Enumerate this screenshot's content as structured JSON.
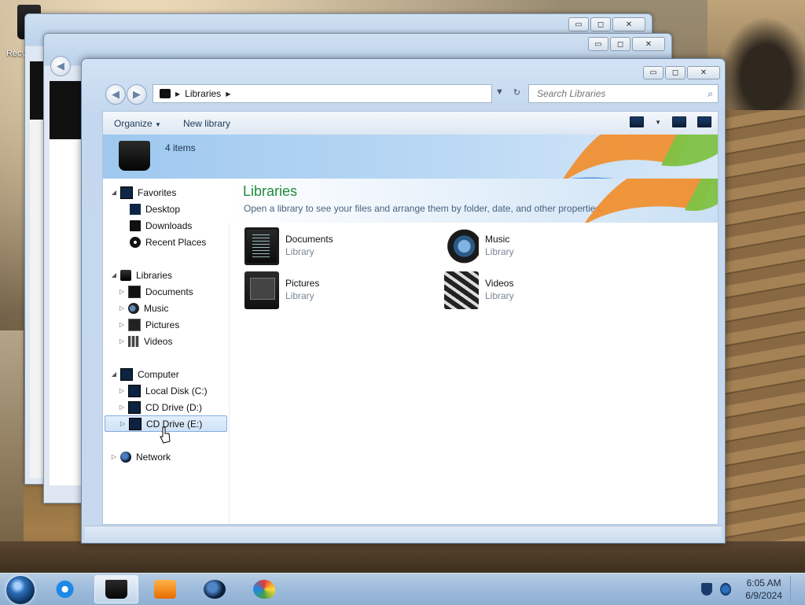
{
  "desktop": {
    "recycle_label": "Recycle Bin"
  },
  "window": {
    "buttons": {
      "minimize": "▭",
      "maximize": "◻",
      "close": "✕"
    },
    "address": {
      "crumbs": [
        "Libraries"
      ],
      "search_placeholder": "Search Libraries"
    },
    "toolbar": {
      "organize": "Organize",
      "new_library": "New library"
    },
    "header": {
      "item_count": "4 items"
    },
    "nav": {
      "favorites": {
        "label": "Favorites",
        "items": [
          "Desktop",
          "Downloads",
          "Recent Places"
        ]
      },
      "libraries": {
        "label": "Libraries",
        "items": [
          "Documents",
          "Music",
          "Pictures",
          "Videos"
        ]
      },
      "computer": {
        "label": "Computer",
        "items": [
          "Local Disk (C:)",
          "CD Drive (D:)",
          "CD Drive (E:)"
        ]
      },
      "network": {
        "label": "Network"
      }
    },
    "content": {
      "title": "Libraries",
      "description": "Open a library to see your files and arrange them by folder, date, and other properties.",
      "libraries": [
        {
          "name": "Documents",
          "type": "Library",
          "icon": "documents-icon"
        },
        {
          "name": "Music",
          "type": "Library",
          "icon": "music-icon"
        },
        {
          "name": "Pictures",
          "type": "Library",
          "icon": "pictures-icon"
        },
        {
          "name": "Videos",
          "type": "Library",
          "icon": "videos-icon"
        }
      ]
    }
  },
  "taskbar": {
    "apps": [
      "internet-explorer-icon",
      "explorer-icon",
      "media-player-icon",
      "globe-icon",
      "paint-icon"
    ],
    "clock": {
      "time": "6:05 AM",
      "date": "6/9/2024"
    }
  },
  "colors": {
    "accent_title": "#1e8b3b",
    "selection": "#cfe2f8",
    "taskbar": "#9fbcdc"
  }
}
